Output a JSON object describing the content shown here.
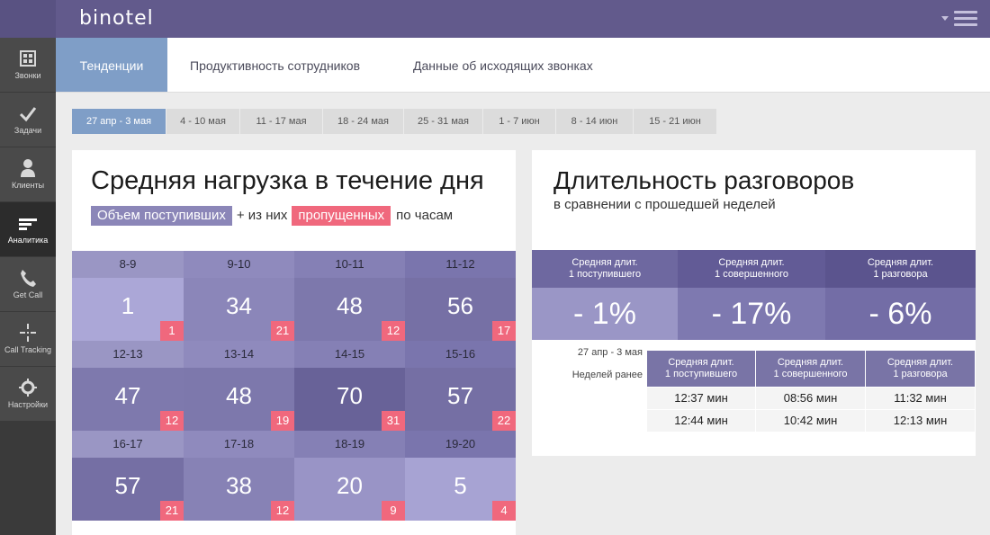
{
  "app": {
    "logo": "binotel"
  },
  "sidebar": {
    "items": [
      {
        "label": "Звонки",
        "icon": "phone-grid-icon"
      },
      {
        "label": "Задачи",
        "icon": "check-icon"
      },
      {
        "label": "Клиенты",
        "icon": "person-icon"
      },
      {
        "label": "Аналитика",
        "icon": "analytics-icon",
        "active": true
      },
      {
        "label": "Get Call",
        "icon": "handset-icon"
      },
      {
        "label": "Call Tracking",
        "icon": "crosshair-icon"
      },
      {
        "label": "Настройки",
        "icon": "gear-icon"
      }
    ]
  },
  "tabs": [
    {
      "label": "Тенденции",
      "active": true
    },
    {
      "label": "Продуктивность сотрудников"
    },
    {
      "label": "Данные об исходящих звонках"
    }
  ],
  "weeks": [
    {
      "label": "27 апр - 3 мая",
      "active": true
    },
    {
      "label": "4 - 10 мая"
    },
    {
      "label": "11 - 17 мая"
    },
    {
      "label": "18 - 24 мая"
    },
    {
      "label": "25 - 31 мая"
    },
    {
      "label": "1 - 7 июн"
    },
    {
      "label": "8 - 14 июн"
    },
    {
      "label": "15 - 21 июн"
    }
  ],
  "load_card": {
    "title": "Средняя нагрузка в течение дня",
    "legend_incoming": "Объем поступивших",
    "legend_plus": "+ из них",
    "legend_missed": "пропущенных",
    "legend_per": "по часам",
    "hours": [
      {
        "range": "8-9",
        "incoming": 1,
        "missed": 1
      },
      {
        "range": "9-10",
        "incoming": 34,
        "missed": 21
      },
      {
        "range": "10-11",
        "incoming": 48,
        "missed": 12
      },
      {
        "range": "11-12",
        "incoming": 56,
        "missed": 17
      },
      {
        "range": "12-13",
        "incoming": 47,
        "missed": 12
      },
      {
        "range": "13-14",
        "incoming": 48,
        "missed": 19
      },
      {
        "range": "14-15",
        "incoming": 70,
        "missed": 31
      },
      {
        "range": "15-16",
        "incoming": 57,
        "missed": 22
      },
      {
        "range": "16-17",
        "incoming": 57,
        "missed": 21
      },
      {
        "range": "17-18",
        "incoming": 38,
        "missed": 12
      },
      {
        "range": "18-19",
        "incoming": 20,
        "missed": 9
      },
      {
        "range": "19-20",
        "incoming": 5,
        "missed": 4
      }
    ]
  },
  "duration_card": {
    "title": "Длительность разговоров",
    "subtitle": "в сравнении с прошедшей неделей",
    "metrics": [
      {
        "label_line1": "Средняя длит.",
        "label_line2": "1 поступившего",
        "change": "- 1%"
      },
      {
        "label_line1": "Средняя длит.",
        "label_line2": "1 совершенного",
        "change": "- 17%"
      },
      {
        "label_line1": "Средняя длит.",
        "label_line2": "1 разговора",
        "change": "- 6%"
      }
    ],
    "compare": {
      "current_label": "27 апр - 3 мая",
      "previous_label": "Неделей ранее",
      "columns": [
        {
          "line1": "Средняя длит.",
          "line2": "1 поступившего"
        },
        {
          "line1": "Средняя длит.",
          "line2": "1 совершенного"
        },
        {
          "line1": "Средняя длит.",
          "line2": "1 разговора"
        }
      ],
      "rows": [
        [
          "12:37 мин",
          "08:56 мин",
          "11:32 мин"
        ],
        [
          "12:44 мин",
          "10:42 мин",
          "12:13 мин"
        ]
      ]
    }
  },
  "colors": {
    "topbar": "#625a8c",
    "active_tab": "#7f9ec7",
    "missed": "#f0687d",
    "legend_incoming": "#8b86b8"
  }
}
